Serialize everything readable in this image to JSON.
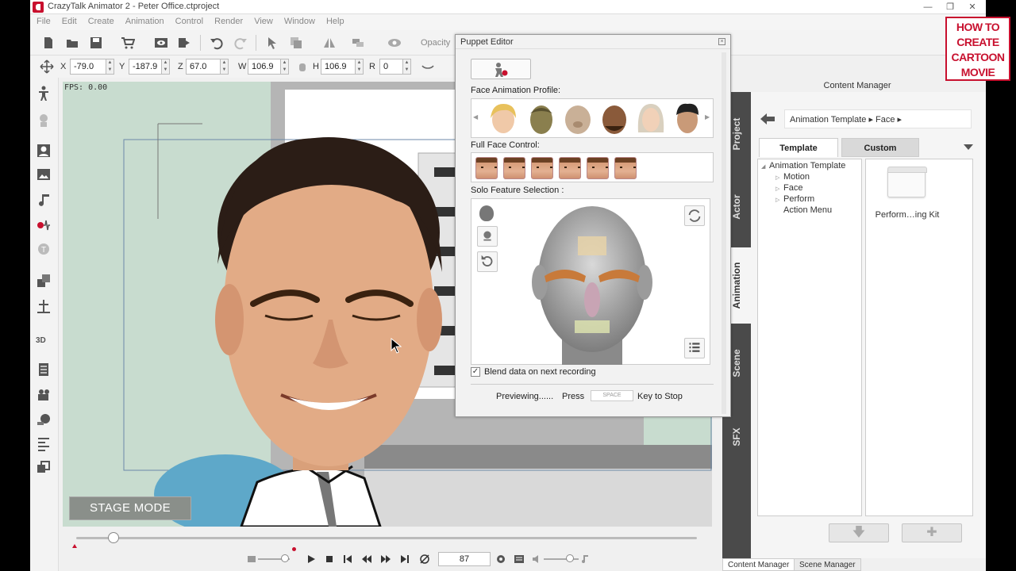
{
  "window": {
    "title": "CrazyTalk Animator 2    - Peter Office.ctproject",
    "controls": [
      "—",
      "❐",
      "✕"
    ]
  },
  "menu": [
    "File",
    "Edit",
    "Create",
    "Animation",
    "Control",
    "Render",
    "View",
    "Window",
    "Help"
  ],
  "toolbar": {
    "opacity_label": "Opacity"
  },
  "transform": {
    "x_label": "X",
    "x_value": "-79.0",
    "y_label": "Y",
    "y_value": "-187.9",
    "z_label": "Z",
    "z_value": "67.0",
    "w_label": "W",
    "w_value": "106.9",
    "h_label": "H",
    "h_value": "106.9",
    "r_label": "R",
    "r_value": "0"
  },
  "stage": {
    "fps": "FPS: 0.00",
    "mode_button": "STAGE MODE"
  },
  "timeline": {
    "frame": "87",
    "progress_fraction": 0.06
  },
  "puppet_editor": {
    "title": "Puppet Editor",
    "face_profile_label": "Face Animation Profile:",
    "full_face_label": "Full Face Control:",
    "solo_feature_label": "Solo Feature Selection :",
    "blend_label": "Blend data on next  recording",
    "blend_checked": true,
    "previewing": "Previewing......",
    "press": "Press",
    "space_key": "SPACE",
    "key_to_stop": "Key to Stop"
  },
  "content_manager": {
    "title": "Content Manager",
    "breadcrumb": "Animation Template ▸ Face ▸",
    "tabs": [
      "Template",
      "Custom"
    ],
    "tree": [
      {
        "label": "Animation Template",
        "level": 0,
        "caret": "◢"
      },
      {
        "label": "Motion",
        "level": 1,
        "caret": "▷"
      },
      {
        "label": "Face",
        "level": 1,
        "caret": "▷"
      },
      {
        "label": "Perform",
        "level": 1,
        "caret": "▷"
      },
      {
        "label": "Action Menu",
        "level": 1,
        "caret": ""
      }
    ],
    "item_label": "Perform…ing Kit",
    "side_tabs": [
      "Project",
      "Actor",
      "Animation",
      "Scene",
      "SFX"
    ],
    "active_side_tab": "Animation"
  },
  "bottom_tabs": [
    "Content Manager",
    "Scene Manager"
  ],
  "badge": {
    "lines": [
      "HOW TO",
      "CREATE",
      "CARTOON",
      "MOVIE"
    ]
  },
  "colors": {
    "accent_red": "#c8102e",
    "stage_green": "#c8dccf",
    "side_tab_bg": "#4a4a4a"
  }
}
